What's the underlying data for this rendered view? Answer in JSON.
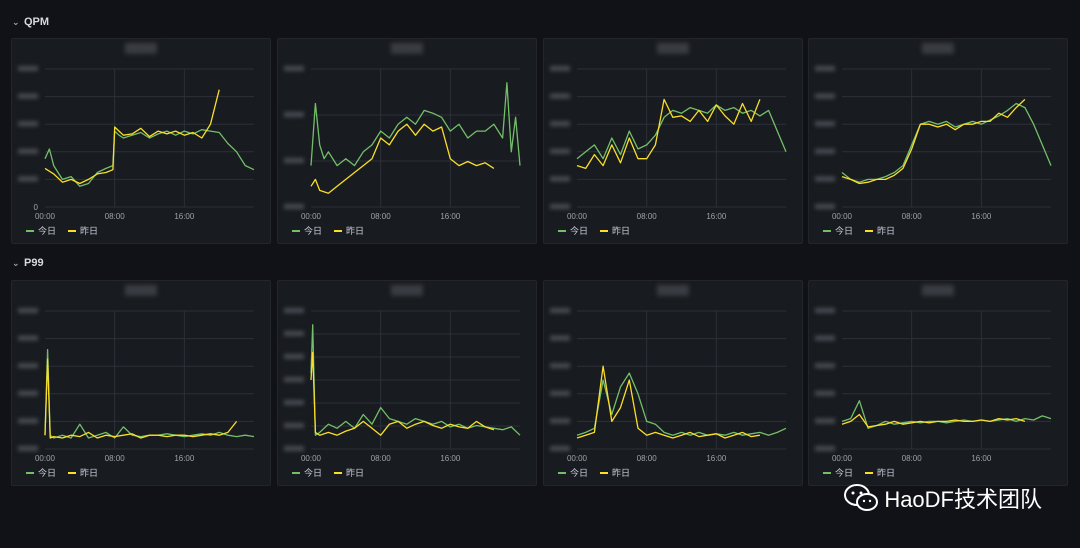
{
  "sections": [
    {
      "label": "QPM"
    },
    {
      "label": "P99"
    }
  ],
  "legend": {
    "today": "今日",
    "yesterday": "昨日"
  },
  "colors": {
    "today": "#73bf69",
    "yesterday": "#fade2a",
    "grid": "#2c3038",
    "axis_text": "#9fa2a8"
  },
  "x_ticks": [
    "00:00",
    "08:00",
    "16:00"
  ],
  "panels": [
    {
      "section": 0,
      "y_ticks": [
        "",
        "",
        "",
        "",
        "",
        "0"
      ],
      "y_blur": true
    },
    {
      "section": 0,
      "y_ticks": [
        "",
        "",
        "",
        ""
      ],
      "y_blur": true
    },
    {
      "section": 0,
      "y_ticks": [
        "",
        "",
        "",
        "",
        "",
        ""
      ],
      "y_blur": true
    },
    {
      "section": 0,
      "y_ticks": [
        "",
        "",
        "",
        "",
        "",
        ""
      ],
      "y_blur": true
    },
    {
      "section": 1,
      "y_ticks": [
        "",
        "",
        "",
        "",
        "",
        ""
      ],
      "y_blur": true
    },
    {
      "section": 1,
      "y_ticks": [
        "",
        "",
        "",
        "",
        "",
        "",
        ""
      ],
      "y_blur": true
    },
    {
      "section": 1,
      "y_ticks": [
        "",
        "",
        "",
        "",
        "",
        ""
      ],
      "y_blur": true
    },
    {
      "section": 1,
      "y_ticks": [
        "",
        "",
        "",
        "",
        "",
        ""
      ],
      "y_blur": true
    }
  ],
  "chart_data": [
    {
      "type": "line",
      "x_range": [
        0,
        24
      ],
      "ylim": [
        0,
        1
      ],
      "series": [
        {
          "name": "今日",
          "x": [
            0,
            0.5,
            1,
            2,
            3,
            4,
            5,
            6,
            7,
            7.8,
            8,
            8.5,
            9,
            10,
            11,
            12,
            13,
            14,
            15,
            16,
            17,
            18,
            19,
            20,
            21,
            22,
            23,
            24
          ],
          "values": [
            0.35,
            0.42,
            0.3,
            0.2,
            0.22,
            0.15,
            0.17,
            0.25,
            0.28,
            0.3,
            0.55,
            0.52,
            0.5,
            0.52,
            0.54,
            0.5,
            0.53,
            0.55,
            0.52,
            0.55,
            0.53,
            0.56,
            0.55,
            0.54,
            0.46,
            0.4,
            0.3,
            0.27
          ]
        },
        {
          "name": "昨日",
          "x": [
            0,
            1,
            2,
            3,
            4,
            5,
            6,
            7,
            7.8,
            8,
            8.5,
            9,
            10,
            11,
            12,
            13,
            14,
            15,
            16,
            17,
            18,
            19,
            20
          ],
          "values": [
            0.28,
            0.24,
            0.18,
            0.2,
            0.17,
            0.2,
            0.24,
            0.25,
            0.27,
            0.58,
            0.55,
            0.52,
            0.53,
            0.57,
            0.51,
            0.55,
            0.53,
            0.55,
            0.52,
            0.54,
            0.5,
            0.6,
            0.85
          ]
        }
      ]
    },
    {
      "type": "line",
      "x_range": [
        0,
        24
      ],
      "ylim": [
        0,
        1
      ],
      "series": [
        {
          "name": "今日",
          "x": [
            0,
            0.5,
            1,
            1.5,
            2,
            3,
            4,
            5,
            6,
            7,
            8,
            9,
            10,
            11,
            12,
            13,
            14,
            15,
            16,
            17,
            18,
            19,
            20,
            21,
            22,
            22.5,
            23,
            23.5,
            24
          ],
          "values": [
            0.3,
            0.75,
            0.45,
            0.35,
            0.4,
            0.3,
            0.35,
            0.3,
            0.4,
            0.45,
            0.55,
            0.5,
            0.6,
            0.65,
            0.6,
            0.7,
            0.68,
            0.65,
            0.55,
            0.6,
            0.5,
            0.55,
            0.55,
            0.6,
            0.5,
            0.9,
            0.4,
            0.65,
            0.3
          ]
        },
        {
          "name": "昨日",
          "x": [
            0,
            0.5,
            1,
            2,
            3,
            4,
            5,
            6,
            7,
            8,
            9,
            10,
            11,
            12,
            13,
            14,
            15,
            16,
            17,
            18,
            19,
            20,
            21
          ],
          "values": [
            0.15,
            0.2,
            0.12,
            0.1,
            0.15,
            0.2,
            0.25,
            0.3,
            0.35,
            0.5,
            0.45,
            0.55,
            0.6,
            0.52,
            0.6,
            0.55,
            0.58,
            0.35,
            0.3,
            0.33,
            0.3,
            0.32,
            0.28
          ]
        }
      ]
    },
    {
      "type": "line",
      "x_range": [
        0,
        24
      ],
      "ylim": [
        0,
        1
      ],
      "series": [
        {
          "name": "今日",
          "x": [
            0,
            1,
            2,
            3,
            4,
            5,
            6,
            7,
            8,
            9,
            10,
            11,
            12,
            13,
            14,
            15,
            16,
            17,
            18,
            19,
            20,
            21,
            22,
            23,
            24
          ],
          "values": [
            0.35,
            0.4,
            0.45,
            0.35,
            0.5,
            0.38,
            0.55,
            0.42,
            0.45,
            0.52,
            0.65,
            0.7,
            0.68,
            0.72,
            0.7,
            0.68,
            0.74,
            0.7,
            0.72,
            0.68,
            0.7,
            0.66,
            0.7,
            0.55,
            0.4
          ]
        },
        {
          "name": "昨日",
          "x": [
            0,
            1,
            2,
            3,
            4,
            5,
            6,
            7,
            8,
            9,
            10,
            11,
            12,
            13,
            14,
            15,
            16,
            17,
            18,
            19,
            20,
            21
          ],
          "values": [
            0.3,
            0.28,
            0.38,
            0.3,
            0.45,
            0.32,
            0.5,
            0.35,
            0.35,
            0.45,
            0.78,
            0.65,
            0.66,
            0.62,
            0.7,
            0.62,
            0.74,
            0.66,
            0.6,
            0.75,
            0.62,
            0.78
          ]
        }
      ]
    },
    {
      "type": "line",
      "x_range": [
        0,
        24
      ],
      "ylim": [
        0,
        1
      ],
      "series": [
        {
          "name": "今日",
          "x": [
            0,
            1,
            2,
            3,
            4,
            5,
            6,
            7,
            8,
            9,
            10,
            11,
            12,
            13,
            14,
            15,
            16,
            17,
            18,
            19,
            20,
            21,
            22,
            23,
            24
          ],
          "values": [
            0.25,
            0.2,
            0.18,
            0.2,
            0.2,
            0.22,
            0.25,
            0.3,
            0.45,
            0.6,
            0.62,
            0.6,
            0.62,
            0.58,
            0.6,
            0.62,
            0.6,
            0.63,
            0.66,
            0.7,
            0.75,
            0.72,
            0.6,
            0.45,
            0.3
          ]
        },
        {
          "name": "昨日",
          "x": [
            0,
            1,
            2,
            3,
            4,
            5,
            6,
            7,
            8,
            9,
            10,
            11,
            12,
            13,
            14,
            15,
            16,
            17,
            18,
            19,
            20,
            21
          ],
          "values": [
            0.22,
            0.2,
            0.17,
            0.18,
            0.2,
            0.2,
            0.23,
            0.28,
            0.42,
            0.6,
            0.6,
            0.58,
            0.6,
            0.56,
            0.6,
            0.6,
            0.62,
            0.62,
            0.68,
            0.65,
            0.72,
            0.78
          ]
        }
      ]
    },
    {
      "type": "line",
      "x_range": [
        0,
        24
      ],
      "ylim": [
        0,
        1
      ],
      "series": [
        {
          "name": "今日",
          "x": [
            0,
            0.3,
            0.6,
            1,
            2,
            3,
            4,
            5,
            6,
            7,
            8,
            9,
            10,
            11,
            12,
            13,
            14,
            15,
            16,
            17,
            18,
            19,
            20,
            21,
            22,
            23,
            24
          ],
          "values": [
            0.1,
            0.72,
            0.1,
            0.08,
            0.1,
            0.08,
            0.18,
            0.08,
            0.1,
            0.12,
            0.08,
            0.16,
            0.1,
            0.09,
            0.1,
            0.1,
            0.11,
            0.1,
            0.09,
            0.1,
            0.11,
            0.1,
            0.12,
            0.1,
            0.09,
            0.1,
            0.09
          ]
        },
        {
          "name": "昨日",
          "x": [
            0,
            0.3,
            0.6,
            1,
            2,
            3,
            4,
            5,
            6,
            7,
            8,
            9,
            10,
            11,
            12,
            13,
            14,
            15,
            16,
            17,
            18,
            19,
            20,
            21,
            22
          ],
          "values": [
            0.1,
            0.65,
            0.08,
            0.09,
            0.08,
            0.1,
            0.09,
            0.12,
            0.08,
            0.1,
            0.09,
            0.1,
            0.11,
            0.08,
            0.1,
            0.1,
            0.09,
            0.1,
            0.1,
            0.09,
            0.1,
            0.11,
            0.1,
            0.12,
            0.2
          ]
        }
      ]
    },
    {
      "type": "line",
      "x_range": [
        0,
        24
      ],
      "ylim": [
        0,
        1
      ],
      "series": [
        {
          "name": "今日",
          "x": [
            0,
            0.2,
            0.5,
            1,
            2,
            3,
            4,
            5,
            6,
            7,
            8,
            9,
            10,
            11,
            12,
            13,
            14,
            15,
            16,
            17,
            18,
            19,
            20,
            21,
            22,
            23,
            24
          ],
          "values": [
            0.55,
            0.9,
            0.1,
            0.12,
            0.18,
            0.15,
            0.2,
            0.15,
            0.25,
            0.18,
            0.3,
            0.22,
            0.2,
            0.18,
            0.22,
            0.2,
            0.18,
            0.2,
            0.16,
            0.18,
            0.15,
            0.17,
            0.16,
            0.15,
            0.14,
            0.16,
            0.1
          ]
        },
        {
          "name": "昨日",
          "x": [
            0,
            0.2,
            0.5,
            1,
            2,
            3,
            4,
            5,
            6,
            7,
            8,
            9,
            10,
            11,
            12,
            13,
            14,
            15,
            16,
            17,
            18,
            19,
            20,
            21
          ],
          "values": [
            0.5,
            0.7,
            0.12,
            0.1,
            0.12,
            0.1,
            0.13,
            0.15,
            0.2,
            0.15,
            0.1,
            0.18,
            0.2,
            0.15,
            0.18,
            0.2,
            0.17,
            0.15,
            0.18,
            0.16,
            0.15,
            0.2,
            0.16,
            0.14
          ]
        }
      ]
    },
    {
      "type": "line",
      "x_range": [
        0,
        24
      ],
      "ylim": [
        0,
        1
      ],
      "series": [
        {
          "name": "今日",
          "x": [
            0,
            1,
            2,
            3,
            4,
            5,
            6,
            7,
            8,
            9,
            10,
            11,
            12,
            13,
            14,
            15,
            16,
            17,
            18,
            19,
            20,
            21,
            22,
            23,
            24
          ],
          "values": [
            0.1,
            0.12,
            0.15,
            0.5,
            0.25,
            0.45,
            0.55,
            0.4,
            0.2,
            0.18,
            0.12,
            0.1,
            0.12,
            0.1,
            0.12,
            0.1,
            0.11,
            0.1,
            0.12,
            0.1,
            0.11,
            0.12,
            0.1,
            0.12,
            0.15
          ]
        },
        {
          "name": "昨日",
          "x": [
            0,
            1,
            2,
            3,
            4,
            5,
            6,
            7,
            8,
            9,
            10,
            11,
            12,
            13,
            14,
            15,
            16,
            17,
            18,
            19,
            20,
            21
          ],
          "values": [
            0.08,
            0.1,
            0.12,
            0.6,
            0.2,
            0.3,
            0.5,
            0.15,
            0.1,
            0.12,
            0.1,
            0.08,
            0.1,
            0.12,
            0.09,
            0.1,
            0.11,
            0.08,
            0.1,
            0.12,
            0.09,
            0.1
          ]
        }
      ]
    },
    {
      "type": "line",
      "x_range": [
        0,
        24
      ],
      "ylim": [
        0,
        1
      ],
      "series": [
        {
          "name": "今日",
          "x": [
            0,
            1,
            2,
            3,
            4,
            5,
            6,
            7,
            8,
            9,
            10,
            11,
            12,
            13,
            14,
            15,
            16,
            17,
            18,
            19,
            20,
            21,
            22,
            23,
            24
          ],
          "values": [
            0.2,
            0.22,
            0.35,
            0.15,
            0.17,
            0.2,
            0.18,
            0.19,
            0.2,
            0.19,
            0.2,
            0.2,
            0.19,
            0.2,
            0.21,
            0.2,
            0.21,
            0.2,
            0.21,
            0.22,
            0.2,
            0.22,
            0.21,
            0.24,
            0.22
          ]
        },
        {
          "name": "昨日",
          "x": [
            0,
            1,
            2,
            3,
            4,
            5,
            6,
            7,
            8,
            9,
            10,
            11,
            12,
            13,
            14,
            15,
            16,
            17,
            18,
            19,
            20,
            21
          ],
          "values": [
            0.18,
            0.2,
            0.25,
            0.16,
            0.17,
            0.18,
            0.2,
            0.18,
            0.19,
            0.2,
            0.19,
            0.2,
            0.2,
            0.21,
            0.2,
            0.2,
            0.21,
            0.2,
            0.22,
            0.21,
            0.22,
            0.2
          ]
        }
      ]
    }
  ],
  "watermark": {
    "text": "HaoDF技术团队"
  }
}
